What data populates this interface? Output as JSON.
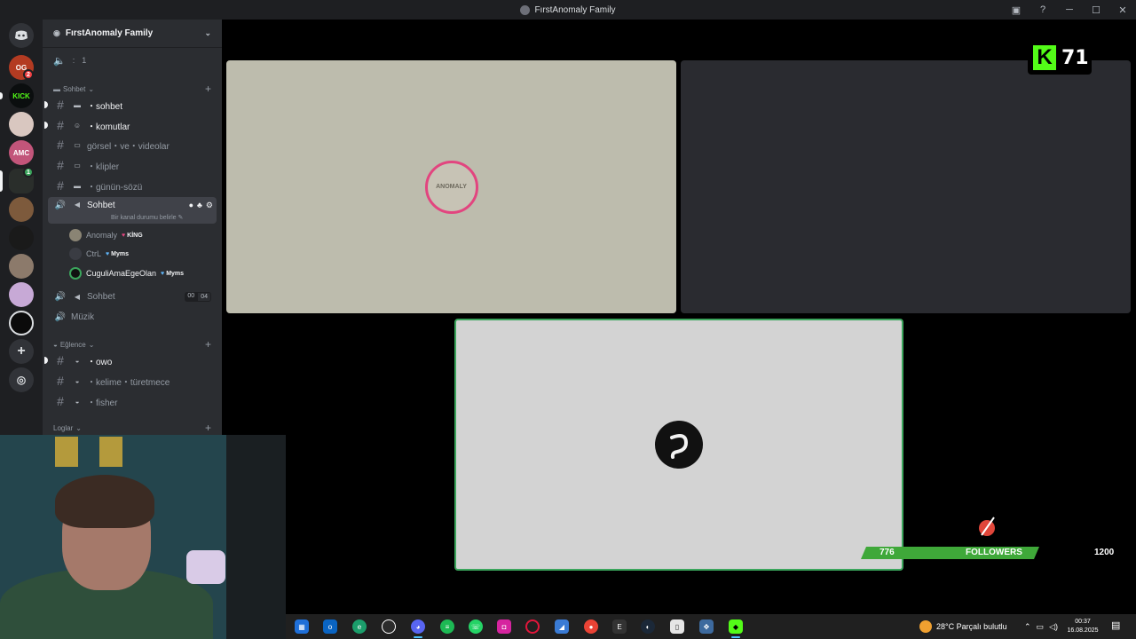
{
  "window": {
    "title": "FırstAnomaly Family",
    "controls": [
      "inbox-icon",
      "help-icon",
      "minimize-icon",
      "maximize-icon",
      "close-icon"
    ]
  },
  "server_rail": {
    "items": [
      {
        "name": "discord-home",
        "label": ""
      },
      {
        "name": "server-0g",
        "label": "OG",
        "badge": "2"
      },
      {
        "name": "server-kick",
        "label": "KICK"
      },
      {
        "name": "server-bus",
        "label": ""
      },
      {
        "name": "server-amc",
        "label": "AMC"
      },
      {
        "name": "server-firstanomaly",
        "label": "",
        "badge": "1"
      },
      {
        "name": "server-anime",
        "label": ""
      },
      {
        "name": "server-dark",
        "label": ""
      },
      {
        "name": "server-face",
        "label": ""
      },
      {
        "name": "server-pink",
        "label": ""
      },
      {
        "name": "server-ring",
        "label": ""
      }
    ],
    "add_server_icon": "plus-icon",
    "discover_icon": "compass-icon"
  },
  "sidebar": {
    "server_name": "FırstAnomaly Family",
    "boost_text": "1",
    "categories": [
      {
        "label": "Sohbet"
      },
      {
        "label": "Eğlence"
      },
      {
        "label": "Loglar"
      }
    ],
    "text_channels_sohbet": [
      {
        "emoji": "speech-bubble-icon",
        "label": "・sohbet",
        "unread": true
      },
      {
        "emoji": "robot-icon",
        "label": "・komutlar",
        "unread": true
      },
      {
        "emoji": "picture-icon",
        "label": "görsel・ve・videolar",
        "unread": false
      },
      {
        "emoji": "tv-icon",
        "label": "・klipler",
        "unread": false
      },
      {
        "emoji": "speech-bubble-icon",
        "label": "・günün-sözü",
        "unread": false
      }
    ],
    "voice_channel_active": {
      "label": "Sohbet",
      "status": "Bir kanal durumu belirle"
    },
    "voice_users": [
      {
        "name": "Anomaly",
        "role": "KİNG",
        "role_color": "#e2457f"
      },
      {
        "name": "CtrL",
        "role": "Myms",
        "role_color": "#5fb3f5"
      },
      {
        "name": "CuguliAmaEgeOlan",
        "role": "Myms",
        "role_color": "#5fb3f5"
      }
    ],
    "voice_channel_2": {
      "label": "Sohbet",
      "count_a": "00",
      "count_b": "04"
    },
    "voice_channel_3": {
      "label": "Müzik"
    },
    "text_channels_eglence": [
      {
        "label": "・owo",
        "unread": true
      },
      {
        "label": "・kelime・türetmece",
        "unread": false
      },
      {
        "label": "・fisher",
        "unread": false
      }
    ]
  },
  "stream_tiles": [
    {
      "name": "Anomaly",
      "avatar_text": "ANOMALY",
      "bg": "#bdbcad"
    },
    {
      "name": "",
      "bg": "#2a2b30"
    },
    {
      "name": "CuguliAmaEgeOlan",
      "bg": "#d3d3d3",
      "speaking": true
    }
  ],
  "kick_overlay": {
    "logo": "K",
    "count": "71",
    "color": "#53fc18"
  },
  "followers": {
    "current": "776",
    "label": "FOLLOWERS",
    "goal": "1200",
    "progress_fraction": 0.647
  },
  "taskbar": {
    "apps": [
      "start-icon",
      "outlook-icon",
      "edge-icon",
      "obs-icon",
      "discord-icon",
      "spotify-icon",
      "whatsapp-icon",
      "instagram-icon",
      "opera-icon",
      "paint-icon",
      "chrome-icon",
      "epic-icon",
      "steam-icon",
      "file-icon",
      "settings-icon",
      "kick-app-icon"
    ],
    "weather": "28°C  Parçalı bulutlu",
    "time": "00:37",
    "date": "16.08.2025"
  }
}
